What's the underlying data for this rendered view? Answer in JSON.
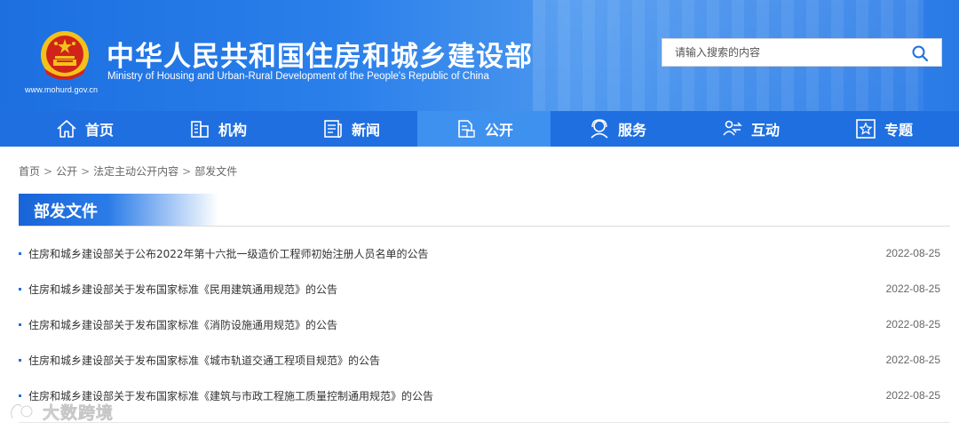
{
  "header": {
    "title_cn": "中华人民共和国住房和城乡建设部",
    "title_en": "Ministry of Housing and Urban-Rural Development of the People's Republic of China",
    "site_url": "www.mohurd.gov.cn",
    "search": {
      "placeholder": "请输入搜索的内容",
      "value": ""
    }
  },
  "nav": {
    "items": [
      {
        "label": "首页",
        "icon": "home-icon"
      },
      {
        "label": "机构",
        "icon": "building-icon"
      },
      {
        "label": "新闻",
        "icon": "news-icon"
      },
      {
        "label": "公开",
        "icon": "document-icon",
        "active": true
      },
      {
        "label": "服务",
        "icon": "service-icon"
      },
      {
        "label": "互动",
        "icon": "interaction-icon"
      },
      {
        "label": "专题",
        "icon": "star-icon"
      }
    ]
  },
  "breadcrumb": [
    "首页",
    "公开",
    "法定主动公开内容",
    "部发文件"
  ],
  "section": {
    "title": "部发文件"
  },
  "articles": [
    {
      "title": "住房和城乡建设部关于公布2022年第十六批一级造价工程师初始注册人员名单的公告",
      "date": "2022-08-25"
    },
    {
      "title": "住房和城乡建设部关于发布国家标准《民用建筑通用规范》的公告",
      "date": "2022-08-25"
    },
    {
      "title": "住房和城乡建设部关于发布国家标准《消防设施通用规范》的公告",
      "date": "2022-08-25"
    },
    {
      "title": "住房和城乡建设部关于发布国家标准《城市轨道交通工程项目规范》的公告",
      "date": "2022-08-25"
    },
    {
      "title": "住房和城乡建设部关于发布国家标准《建筑与市政工程施工质量控制通用规范》的公告",
      "date": "2022-08-25"
    }
  ],
  "watermark": {
    "text": "大数跨境"
  },
  "colors": {
    "brand_blue": "#1f6fe0",
    "nav_active": "#3f91f0",
    "text": "#333333"
  }
}
